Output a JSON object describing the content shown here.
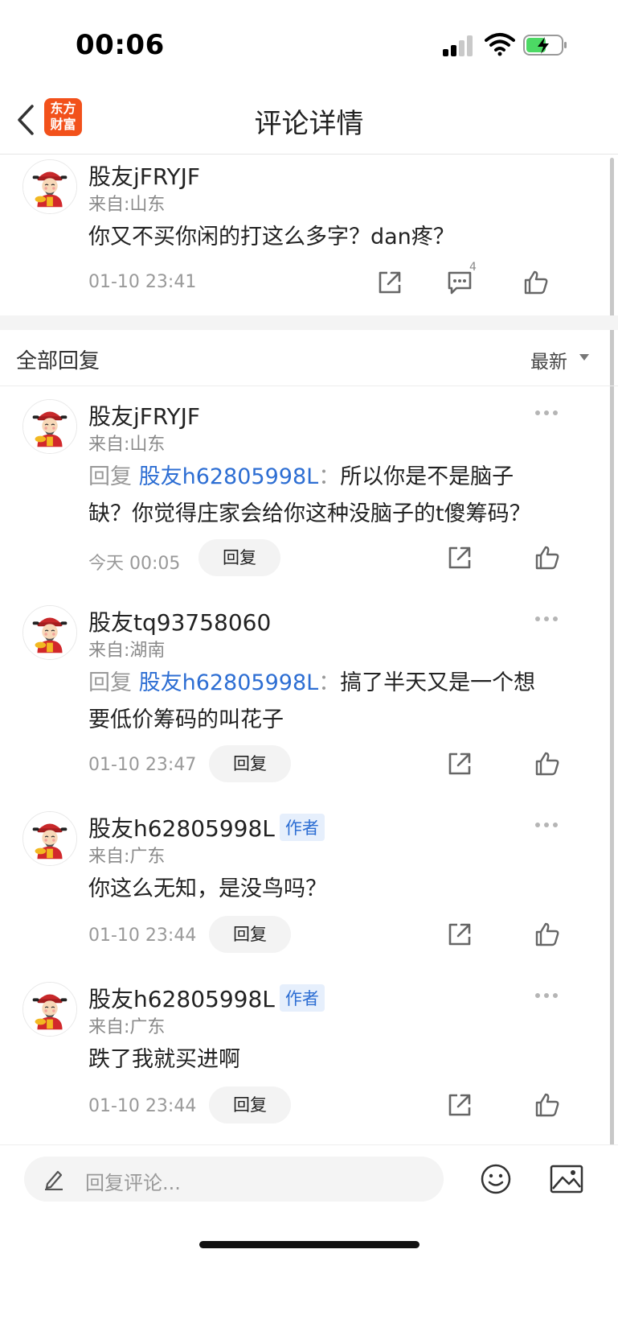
{
  "status_bar": {
    "time": "00:06"
  },
  "header": {
    "logo_line1": "东方",
    "logo_line2": "财富",
    "title": "评论详情"
  },
  "main_comment": {
    "username": "股友jFRYJF",
    "location": "来自:山东",
    "text": "你又不买你闲的打这么多字？dan疼？",
    "time": "01-10 23:41",
    "comment_count": "4"
  },
  "replies_section": {
    "title": "全部回复",
    "sort_label": "最新"
  },
  "replies": [
    {
      "username": "股友jFRYJF",
      "location": "来自:山东",
      "reply_prefix": "回复",
      "reply_target": "股友h62805998L",
      "reply_colon": "：",
      "text_line1": "所以你是不是脑子",
      "text_line2": "缺？你觉得庄家会给你这种没脑子的t傻筹码？",
      "time": "今天 00:05",
      "reply_label": "回复"
    },
    {
      "username": "股友tq93758060",
      "location": "来自:湖南",
      "reply_prefix": "回复",
      "reply_target": "股友h62805998L",
      "reply_colon": "：",
      "text_line1": "搞了半天又是一个想",
      "text_line2": "要低价筹码的叫花子",
      "time": "01-10 23:47",
      "reply_label": "回复"
    },
    {
      "username": "股友h62805998L",
      "author_tag": "作者",
      "location": "来自:广东",
      "text": "你这么无知，是没鸟吗？",
      "time": "01-10 23:44",
      "reply_label": "回复"
    },
    {
      "username": "股友h62805998L",
      "author_tag": "作者",
      "location": "来自:广东",
      "text": "跌了我就买进啊",
      "time": "01-10 23:44",
      "reply_label": "回复"
    }
  ],
  "bottom_bar": {
    "placeholder": "回复评论..."
  },
  "colors": {
    "brand": "#f2511b",
    "link": "#2d6ed3",
    "muted": "#999999"
  },
  "icons": [
    "back-icon",
    "share-icon",
    "comment-icon",
    "like-icon",
    "more-icon",
    "pencil-icon",
    "emoji-icon",
    "image-icon"
  ]
}
